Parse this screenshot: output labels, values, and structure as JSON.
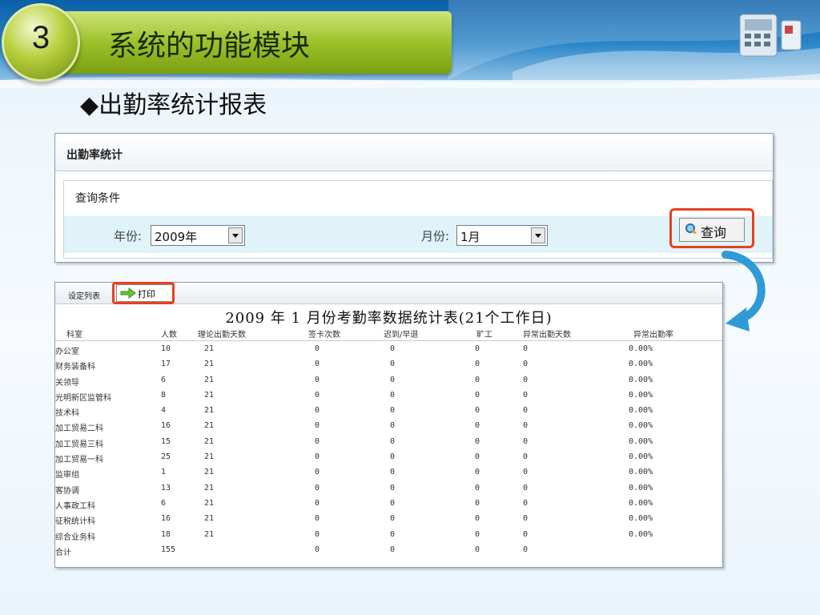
{
  "slide": {
    "section_number": "3",
    "title": "系统的功能模块",
    "subtitle": "◆出勤率统计报表"
  },
  "query_panel": {
    "title": "出勤率统计",
    "condition_title": "查询条件",
    "year_label": "年份:",
    "year_value": "2009年",
    "month_label": "月份:",
    "month_value": "1月",
    "query_button_label": "查询"
  },
  "table_panel": {
    "tab_label": "设定列表",
    "print_button_label": "打印",
    "report_title": "2009 年 1 月份考勤率数据统计表(21个工作日)",
    "columns": [
      "科室",
      "人数",
      "理论出勤天数",
      "签卡次数",
      "迟到/早退",
      "旷工",
      "异常出勤天数",
      "异常出勤率"
    ],
    "rows": [
      [
        "办公室",
        "10",
        "21",
        "0",
        "0",
        "0",
        "0",
        "0.00%"
      ],
      [
        "财务装备科",
        "17",
        "21",
        "0",
        "0",
        "0",
        "0",
        "0.00%"
      ],
      [
        "关领导",
        "6",
        "21",
        "0",
        "0",
        "0",
        "0",
        "0.00%"
      ],
      [
        "光明新区监管科",
        "8",
        "21",
        "0",
        "0",
        "0",
        "0",
        "0.00%"
      ],
      [
        "技术科",
        "4",
        "21",
        "0",
        "0",
        "0",
        "0",
        "0.00%"
      ],
      [
        "加工贸易二科",
        "16",
        "21",
        "0",
        "0",
        "0",
        "0",
        "0.00%"
      ],
      [
        "加工贸易三科",
        "15",
        "21",
        "0",
        "0",
        "0",
        "0",
        "0.00%"
      ],
      [
        "加工贸易一科",
        "25",
        "21",
        "0",
        "0",
        "0",
        "0",
        "0.00%"
      ],
      [
        "监审组",
        "1",
        "21",
        "0",
        "0",
        "0",
        "0",
        "0.00%"
      ],
      [
        "客协调",
        "13",
        "21",
        "0",
        "0",
        "0",
        "0",
        "0.00%"
      ],
      [
        "人事政工科",
        "6",
        "21",
        "0",
        "0",
        "0",
        "0",
        "0.00%"
      ],
      [
        "征税统计科",
        "16",
        "21",
        "0",
        "0",
        "0",
        "0",
        "0.00%"
      ],
      [
        "综合业务科",
        "18",
        "21",
        "0",
        "0",
        "0",
        "0",
        "0.00%"
      ],
      [
        "合计",
        "155",
        "",
        "0",
        "0",
        "0",
        "0",
        ""
      ]
    ]
  },
  "colors": {
    "highlight": "#e8401f",
    "accent_arrow": "#2e9bd6",
    "title_green": "#9cc12a"
  },
  "icons": [
    "magnifier-icon",
    "print-arrow-icon",
    "curved-arrow-icon",
    "device-icon"
  ]
}
